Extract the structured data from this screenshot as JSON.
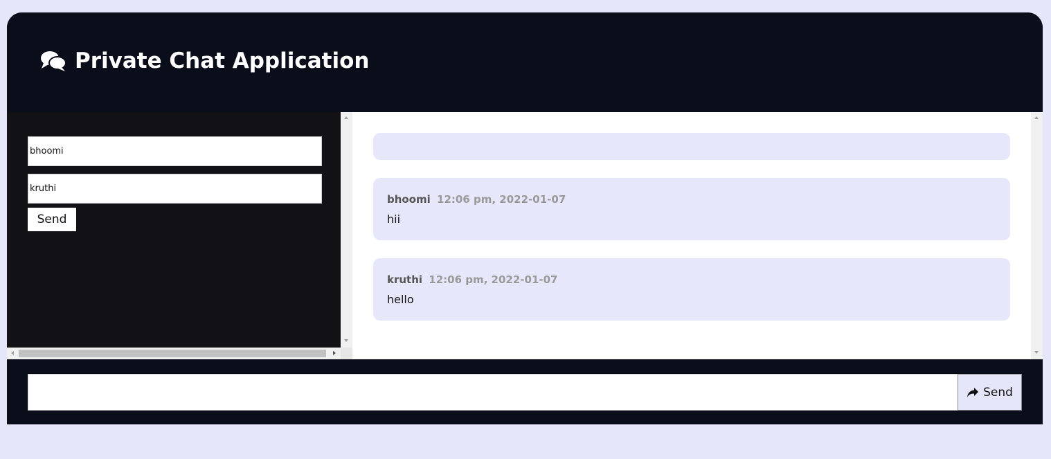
{
  "header": {
    "title": "Private Chat Application",
    "icon": "comments-icon"
  },
  "sidebar": {
    "sender_value": "bhoomi",
    "receiver_value": "kruthi",
    "send_label": "Send"
  },
  "messages": [
    {
      "user": "bhoomi",
      "time": "12:06 pm, 2022-01-07",
      "text": "hii"
    },
    {
      "user": "kruthi",
      "time": "12:06 pm, 2022-01-07",
      "text": "hello"
    }
  ],
  "footer": {
    "input_value": "",
    "send_label": "Send",
    "send_icon": "share-icon"
  },
  "colors": {
    "page_bg": "#e6e6fa",
    "header_bg": "#0a0d1a",
    "sidebar_bg": "#111116",
    "message_bg": "#e6e7fb"
  }
}
